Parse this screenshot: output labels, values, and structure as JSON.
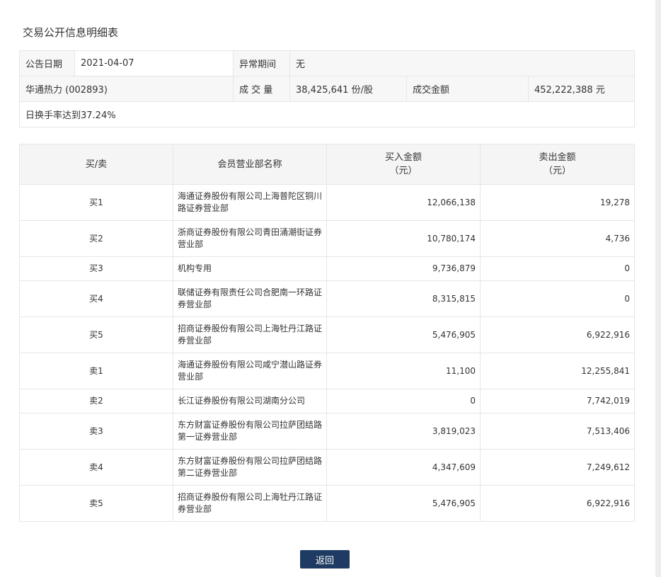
{
  "title": "交易公开信息明细表",
  "info": {
    "announce_date_label": "公告日期",
    "announce_date_value": "2021-04-07",
    "abnormal_period_label": "异常期间",
    "abnormal_period_value": "无",
    "stock_value": "华通热力 (002893)",
    "volume_label": "成 交 量",
    "volume_value": "38,425,641 份/股",
    "amount_label": "成交金额",
    "amount_value": "452,222,388 元",
    "note": "日换手率达到37.24%"
  },
  "detail": {
    "headers": {
      "side": "买/卖",
      "name": "会员营业部名称",
      "buy_line1": "买入金额",
      "buy_line2": "（元）",
      "sell_line1": "卖出金额",
      "sell_line2": "（元）"
    },
    "rows": [
      {
        "side": "买1",
        "name_line1": "海通证券股份有限公司上海普陀区铜川",
        "name_line2": "路证券营业部",
        "buy": "12,066,138",
        "sell": "19,278"
      },
      {
        "side": "买2",
        "name_line1": "浙商证券股份有限公司青田涌潮街证券",
        "name_line2": "营业部",
        "buy": "10,780,174",
        "sell": "4,736"
      },
      {
        "side": "买3",
        "name_line1": "机构专用",
        "name_line2": "",
        "buy": "9,736,879",
        "sell": "0"
      },
      {
        "side": "买4",
        "name_line1": "联储证券有限责任公司合肥南一环路证",
        "name_line2": "券营业部",
        "buy": "8,315,815",
        "sell": "0"
      },
      {
        "side": "买5",
        "name_line1": "招商证券股份有限公司上海牡丹江路证",
        "name_line2": "券营业部",
        "buy": "5,476,905",
        "sell": "6,922,916"
      },
      {
        "side": "卖1",
        "name_line1": "海通证券股份有限公司咸宁潜山路证券",
        "name_line2": "营业部",
        "buy": "11,100",
        "sell": "12,255,841"
      },
      {
        "side": "卖2",
        "name_line1": "长江证券股份有限公司湖南分公司",
        "name_line2": "",
        "buy": "0",
        "sell": "7,742,019"
      },
      {
        "side": "卖3",
        "name_line1": "东方财富证券股份有限公司拉萨团结路",
        "name_line2": "第一证券营业部",
        "buy": "3,819,023",
        "sell": "7,513,406"
      },
      {
        "side": "卖4",
        "name_line1": "东方财富证券股份有限公司拉萨团结路",
        "name_line2": "第二证券营业部",
        "buy": "4,347,609",
        "sell": "7,249,612"
      },
      {
        "side": "卖5",
        "name_line1": "招商证券股份有限公司上海牡丹江路证",
        "name_line2": "券营业部",
        "buy": "5,476,905",
        "sell": "6,922,916"
      }
    ]
  },
  "back_button": "返回",
  "colors": {
    "button_bg": "#1f3b63",
    "header_bg": "#f5f5f5",
    "border": "#e6e6e6"
  }
}
